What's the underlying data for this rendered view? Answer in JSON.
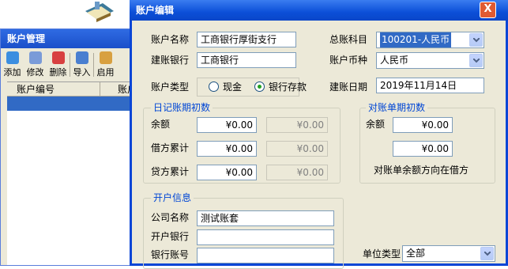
{
  "background_window": {
    "title": "账户管理",
    "toolbar": [
      {
        "label": "添加",
        "icon": "add-icon",
        "color": "#3b8ee0"
      },
      {
        "label": "修改",
        "icon": "edit-icon",
        "color": "#7a9bd8"
      },
      {
        "label": "删除",
        "icon": "delete-icon",
        "color": "#d84040"
      },
      {
        "label": "导入",
        "icon": "import-icon",
        "color": "#4a7fd0"
      },
      {
        "label": "启用",
        "icon": "enable-icon",
        "color": "#d8a040"
      }
    ],
    "list_columns": [
      "账户编号",
      "账户"
    ]
  },
  "dialog": {
    "title": "账户编辑",
    "close_label": "X",
    "account_name_label": "账户名称",
    "account_name_value": "工商银行厚街支行",
    "bank_label": "建账银行",
    "bank_value": "工商银行",
    "account_type_label": "账户类型",
    "type_cash_label": "现金",
    "type_bank_label": "银行存款",
    "ledger_subject_label": "总账科目",
    "ledger_subject_value": "100201-人民币",
    "currency_label": "账户币种",
    "currency_value": "人民币",
    "open_date_label": "建账日期",
    "open_date_value": "2019年11月14日",
    "journal_group": {
      "title": "日记账期初数",
      "rows": [
        {
          "label": "余额",
          "value": "¥0.00",
          "disabled_value": "¥0.00"
        },
        {
          "label": "借方累计",
          "value": "¥0.00",
          "disabled_value": "¥0.00"
        },
        {
          "label": "贷方累计",
          "value": "¥0.00",
          "disabled_value": "¥0.00"
        }
      ]
    },
    "statement_group": {
      "title": "对账单期初数",
      "balance_label": "余额",
      "balance_value": "¥0.00",
      "second_value": "¥0.00",
      "note": "对账单余额方向在借方"
    },
    "open_info_group": {
      "title": "开户信息",
      "company_label": "公司名称",
      "company_value": "测试账套",
      "bank_label": "开户银行",
      "bank_value": "",
      "account_no_label": "银行账号",
      "account_no_value": ""
    },
    "unit_type_label": "单位类型",
    "unit_type_value": "全部"
  }
}
